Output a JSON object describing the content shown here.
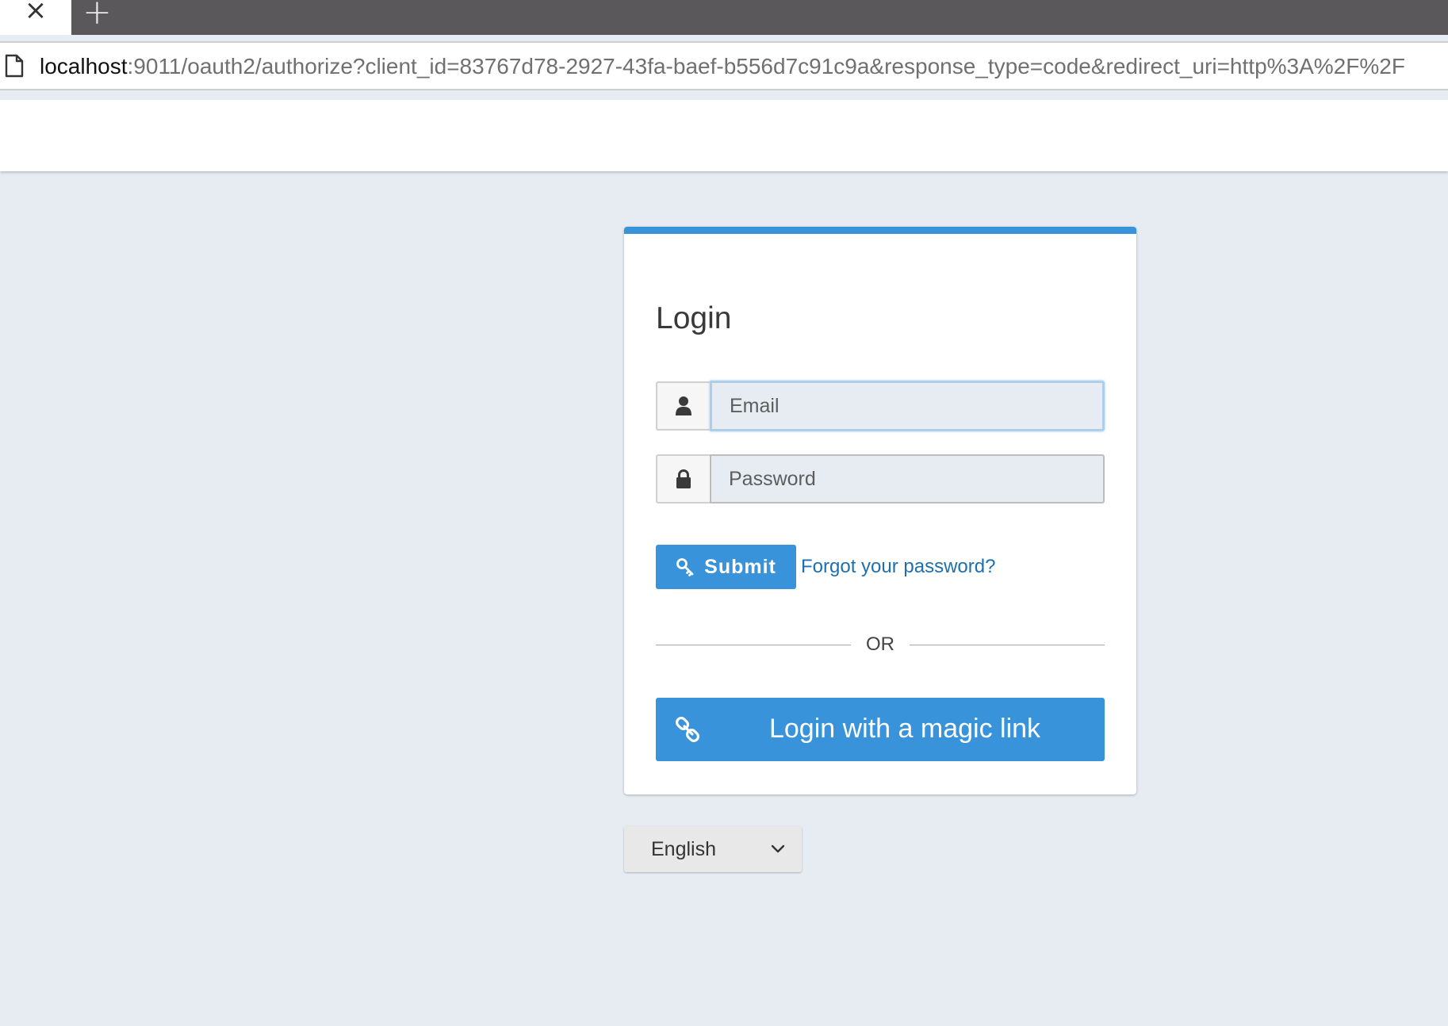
{
  "browser": {
    "tab_close_glyph": "×",
    "new_tab_glyph": "+",
    "url_host": "localhost",
    "url_rest": ":9011/oauth2/authorize?client_id=83767d78-2927-43fa-baef-b556d7c91c9a&response_type=code&redirect_uri=http%3A%2F%2F"
  },
  "login": {
    "title": "Login",
    "email_placeholder": "Email",
    "password_placeholder": "Password",
    "submit_label": "Submit",
    "forgot_label": "Forgot your password?",
    "or_label": "OR",
    "magic_link_label": "Login with a magic link"
  },
  "language": {
    "selected": "English"
  },
  "icons": {
    "user": "user-icon",
    "lock": "lock-icon",
    "key": "key-icon",
    "link": "link-icon",
    "chevron": "chevron-down-icon"
  },
  "colors": {
    "accent": "#3893da",
    "link": "#1e6fb0",
    "page_background": "#e7ecf3"
  }
}
